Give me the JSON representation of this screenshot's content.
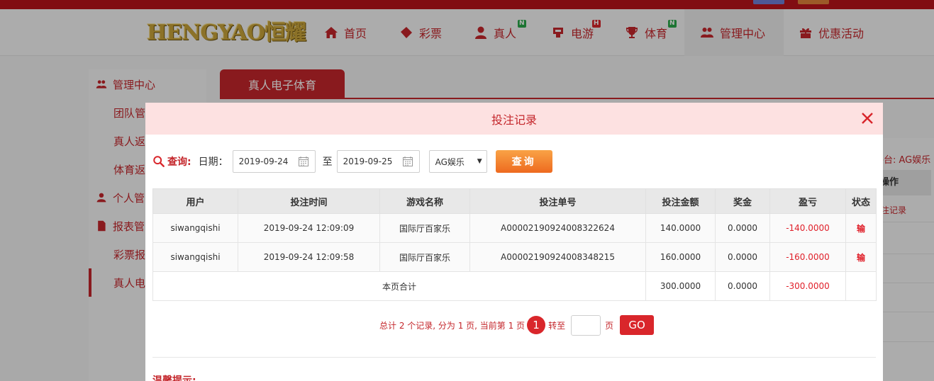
{
  "brand": {
    "logo_text": "HENGYAO恒耀"
  },
  "nav": {
    "items": [
      {
        "label": "首页",
        "icon": "home-icon"
      },
      {
        "label": "彩票",
        "icon": "ticket-icon"
      },
      {
        "label": "真人",
        "icon": "dealer-icon",
        "badge": "N"
      },
      {
        "label": "电游",
        "icon": "arcade-icon",
        "badge": "H"
      },
      {
        "label": "体育",
        "icon": "trophy-icon",
        "badge": "N"
      },
      {
        "label": "管理中心",
        "icon": "users-icon"
      },
      {
        "label": "优惠活动",
        "icon": "gift-icon"
      }
    ],
    "badge_colors": {
      "N": "#2aa84a",
      "H": "#d9262b"
    }
  },
  "sidebar": {
    "items": [
      {
        "label": "管理中心",
        "type": "header"
      },
      {
        "label": "团队管",
        "type": "sub"
      },
      {
        "label": "真人返",
        "type": "sub"
      },
      {
        "label": "体育返",
        "type": "sub"
      },
      {
        "label": "个人管",
        "type": "header"
      },
      {
        "label": "报表管",
        "type": "header"
      },
      {
        "label": "彩票报",
        "type": "sub"
      },
      {
        "label": "真人电",
        "type": "sub"
      }
    ]
  },
  "content": {
    "tab_label": "真人电子体育",
    "platform_text": "平台: AG娱乐",
    "op_header": "操作",
    "op_cell": "注记录"
  },
  "modal": {
    "title": "投注记录",
    "query": {
      "label": "查询:",
      "date_label": "日期：",
      "date_from": "2019-09-24",
      "to_label": "至",
      "date_to": "2019-09-25",
      "platform_selected": "AG娱乐",
      "query_button": "查询"
    },
    "table": {
      "headers": [
        "用户",
        "投注时间",
        "游戏名称",
        "投注单号",
        "投注金额",
        "奖金",
        "盈亏",
        "状态"
      ],
      "rows": [
        [
          "siwangqishi",
          "2019-09-24 12:09:09",
          "国际厅百家乐",
          "A0000219092400832262​4",
          "140.0000",
          "0.0000",
          "-140.0000",
          "输"
        ],
        [
          "siwangqishi",
          "2019-09-24 12:09:58",
          "国际厅百家乐",
          "A00002190924008348215",
          "160.0000",
          "0.0000",
          "-160.0000",
          "输"
        ]
      ],
      "total_label": "本页合计",
      "total": [
        "300.0000",
        "0.0000",
        "-300.0000",
        ""
      ]
    },
    "pager": {
      "summary": "总计 2 个记录, 分为 1 页, 当前第 1 页",
      "current_page": "1",
      "goto_label": "转至",
      "page_unit": "页",
      "go_button": "GO"
    },
    "tip_title": "温馨提示:"
  },
  "colors": {
    "brand_red": "#c4262b",
    "negative": "#e0202a",
    "header_pink": "#fde1e1",
    "query_orange": "#f08b33"
  }
}
